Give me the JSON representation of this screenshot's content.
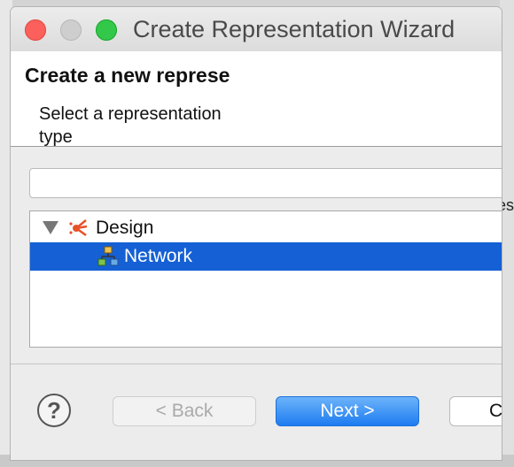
{
  "window": {
    "title": "Create Representation Wizard"
  },
  "header": {
    "title": "Create a new represe",
    "description": "Select a representation type"
  },
  "filter": {
    "value": "",
    "placeholder": ""
  },
  "tree": {
    "nodes": [
      {
        "label": "Design",
        "icon": "design-viewpoint-icon",
        "expanded": true
      },
      {
        "label": "Network",
        "icon": "network-diagram-icon",
        "selected": true
      }
    ]
  },
  "footer": {
    "back_label": "< Back",
    "next_label": "Next >",
    "cancel_label": "C",
    "help_icon": "help-icon"
  },
  "background": {
    "partial_text": "es"
  },
  "colors": {
    "selection": "#1560d4",
    "next_button": "#1d7cf1",
    "design_icon": "#e8512a"
  }
}
